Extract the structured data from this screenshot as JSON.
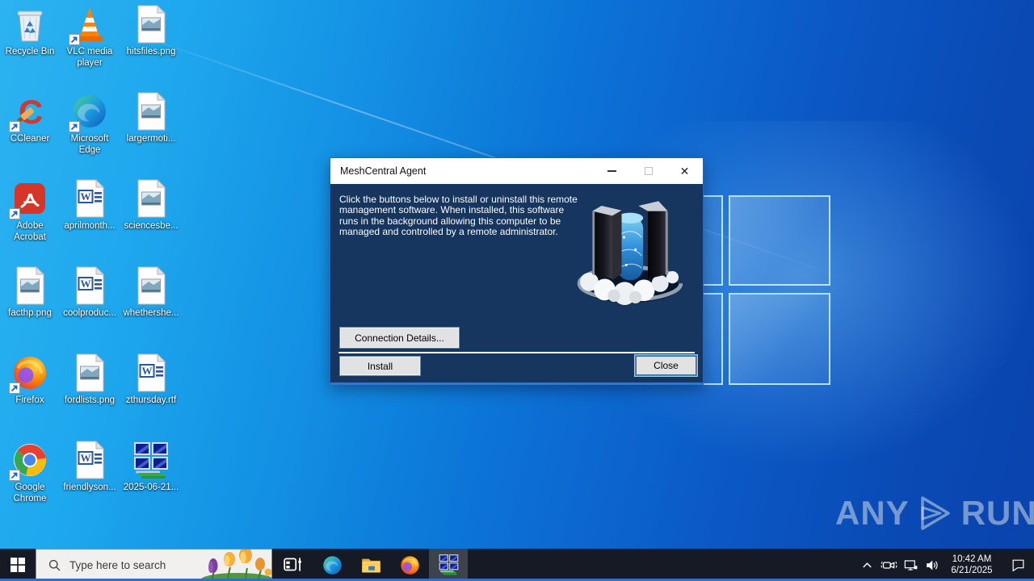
{
  "desktop": {
    "icons": [
      {
        "label": "Recycle Bin",
        "type": "recycle-bin",
        "shortcut": false
      },
      {
        "label": "VLC media player",
        "type": "vlc",
        "shortcut": true
      },
      {
        "label": "hitsfiles.png",
        "type": "image-file",
        "shortcut": false
      },
      {
        "label": "CCleaner",
        "type": "ccleaner",
        "shortcut": true
      },
      {
        "label": "Microsoft Edge",
        "type": "edge",
        "shortcut": true
      },
      {
        "label": "largermoti...",
        "type": "image-file",
        "shortcut": false
      },
      {
        "label": "Adobe Acrobat",
        "type": "acrobat",
        "shortcut": true
      },
      {
        "label": "aprilmonth...",
        "type": "word-file",
        "shortcut": false
      },
      {
        "label": "sciencesbe...",
        "type": "image-file",
        "shortcut": false
      },
      {
        "label": "facthp.png",
        "type": "image-file",
        "shortcut": false
      },
      {
        "label": "coolproduc...",
        "type": "word-file",
        "shortcut": false
      },
      {
        "label": "whethershe...",
        "type": "image-file",
        "shortcut": false
      },
      {
        "label": "Firefox",
        "type": "firefox",
        "shortcut": true
      },
      {
        "label": "fordlists.png",
        "type": "image-file",
        "shortcut": false
      },
      {
        "label": "zthursday.rtf",
        "type": "word-file",
        "shortcut": false
      },
      {
        "label": "Google Chrome",
        "type": "chrome",
        "shortcut": true
      },
      {
        "label": "friendlyson...",
        "type": "word-file",
        "shortcut": false
      },
      {
        "label": "2025-06-21...",
        "type": "mesh-agent",
        "shortcut": false
      }
    ]
  },
  "dialog": {
    "title": "MeshCentral Agent",
    "close_glyph": "✕",
    "body_text": "Click the buttons below to install or uninstall this remote management software. When installed, this software runs in the background allowing this computer to be managed and controlled by a remote administrator.",
    "connection_details_label": "Connection Details...",
    "install_label": "Install",
    "close_label": "Close"
  },
  "taskbar": {
    "search_placeholder": "Type here to search",
    "apps": [
      "task-view",
      "microsoft-edge",
      "file-explorer",
      "firefox",
      "meshcentral-agent"
    ],
    "active_app": "meshcentral-agent",
    "tray": {
      "time": "10:42 AM",
      "date": "6/21/2025"
    }
  },
  "watermark": {
    "left": "ANY",
    "right": "RUN"
  },
  "colors": {
    "accent_blue": "#0078d7",
    "dialog_body": "#16365f",
    "taskbar_bg": "#161a24",
    "wallpaper_left": "#14aaf0",
    "wallpaper_right": "#0a43ac"
  }
}
